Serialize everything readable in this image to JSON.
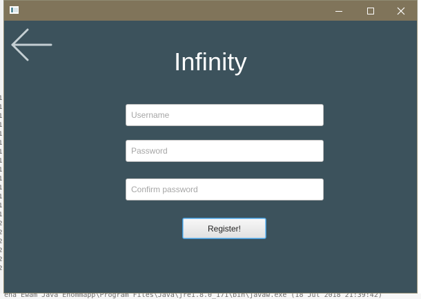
{
  "window": {
    "title": "",
    "controls": {
      "minimize_icon": "minimize-icon",
      "maximize_icon": "maximize-icon",
      "close_icon": "close-icon"
    }
  },
  "screen": {
    "title": "Infinity",
    "back_icon": "arrow-left-icon"
  },
  "form": {
    "username": {
      "value": "",
      "placeholder": "Username"
    },
    "password": {
      "value": "",
      "placeholder": "Password"
    },
    "confirm_password": {
      "value": "",
      "placeholder": "Confirm password"
    },
    "register_label": "Register!"
  },
  "background": {
    "left_lines": [
      "1",
      "1",
      "1",
      "1",
      "1",
      "1",
      "1",
      "1",
      "1",
      "1",
      "1",
      "1",
      "1",
      "1",
      "2",
      "2",
      "2",
      "2",
      "2",
      "2"
    ],
    "bottom_text": "ena Ewam Java Enommapp\\Program Files\\Java\\jre1.8.0_171\\bin\\javaw.exe (18 Jul 2018 21:39:42)"
  },
  "colors": {
    "titlebar": "#80745a",
    "window_background": "#3c525c",
    "title_text": "#ffffff",
    "button_border": "#3f95d2"
  }
}
